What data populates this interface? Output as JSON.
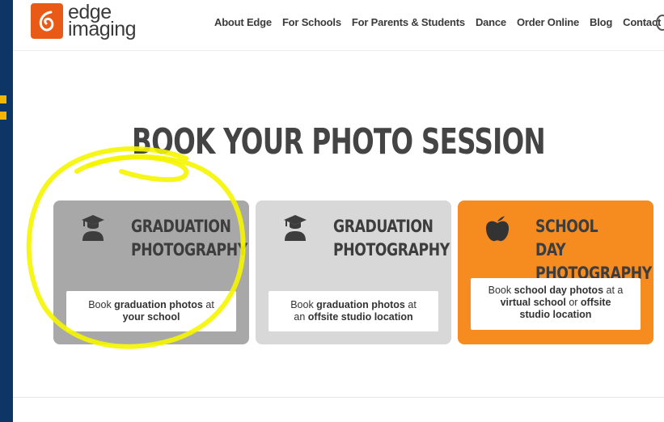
{
  "brand": {
    "name_line1": "edge",
    "name_line2": "imaging",
    "accent": "#ea5a17"
  },
  "nav": {
    "items": [
      "About Edge",
      "For Schools",
      "For Parents & Students",
      "Dance",
      "Order Online",
      "Blog",
      "Contact"
    ]
  },
  "page": {
    "title": "BOOK YOUR PHOTO SESSION"
  },
  "cards": [
    {
      "icon": "graduate-icon",
      "title_line1": "GRADUATION",
      "title_line2": "PHOTOGRAPHY",
      "desc_parts": [
        "Book ",
        "graduation photos",
        " at ",
        "your school"
      ],
      "color": "#a8a8a8"
    },
    {
      "icon": "graduate-icon",
      "title_line1": "GRADUATION",
      "title_line2": "PHOTOGRAPHY",
      "desc_parts": [
        "Book ",
        "graduation photos",
        " at ",
        "an ",
        "offsite studio location"
      ],
      "color": "#d8d8d8"
    },
    {
      "icon": "apple-icon",
      "title_line1": "SCHOOL DAY",
      "title_line2": "PHOTOGRAPHY",
      "desc_parts": [
        "Book ",
        "school day photos",
        " at a ",
        "virtual school",
        " or ",
        "offsite",
        " ",
        "studio location"
      ],
      "color": "#f68b1f"
    }
  ],
  "annotation": {
    "color": "#f5f500"
  }
}
